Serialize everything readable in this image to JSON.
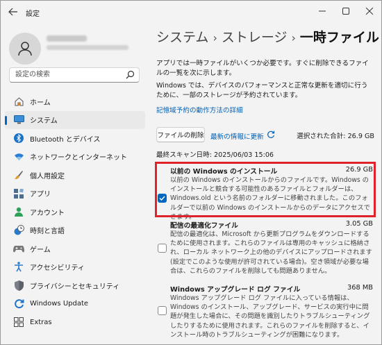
{
  "window": {
    "title": "設定"
  },
  "user": {
    "name": "",
    "email": ""
  },
  "search": {
    "placeholder": "設定の検索"
  },
  "nav": {
    "items": [
      {
        "label": "ホーム",
        "icon": "home-icon"
      },
      {
        "label": "システム",
        "icon": "monitor-icon",
        "active": true
      },
      {
        "label": "Bluetooth とデバイス",
        "icon": "bluetooth-icon"
      },
      {
        "label": "ネットワークとインターネット",
        "icon": "wifi-icon"
      },
      {
        "label": "個人用設定",
        "icon": "brush-icon"
      },
      {
        "label": "アプリ",
        "icon": "apps-icon"
      },
      {
        "label": "アカウント",
        "icon": "person-icon"
      },
      {
        "label": "時刻と言語",
        "icon": "clock-globe-icon"
      },
      {
        "label": "ゲーム",
        "icon": "gamepad-icon"
      },
      {
        "label": "アクセシビリティ",
        "icon": "accessibility-icon"
      },
      {
        "label": "プライバシーとセキュリティ",
        "icon": "shield-icon"
      },
      {
        "label": "Windows Update",
        "icon": "update-icon"
      },
      {
        "label": "Extras",
        "icon": "extras-icon"
      }
    ]
  },
  "breadcrumb": {
    "part1": "システム",
    "part2": "ストレージ",
    "current": "一時ファイル",
    "separator": "›"
  },
  "intro": {
    "text1": "アプリでは一時ファイルがいくつか必要です。すぐに削除できるファイルの一覧を次に示します。",
    "text2": "Windows では、デバイスのパフォーマンスと正常な更新を適切に行うために、一部のストレージが予約されています。",
    "link": "記憶域予約の動作方法の詳細"
  },
  "actions": {
    "delete_label": "ファイルの削除",
    "refresh_label": "最新の情報に更新",
    "selected_total": "選択された合計: 26.9 GB",
    "last_scan": "最終スキャン日時: 2025/06/03 15:06"
  },
  "files": [
    {
      "title": "以前の Windows のインストール",
      "size": "26.9 GB",
      "checked": true,
      "desc": "以前の Windows のインストールからのファイルです。Windows のインストールと競合する可能性のあるファイルとフォルダーは、Windows.old という名前のフォルダーに移動されました。このフォルダーで以前の Windows のインストールからのデータにアクセスできます。"
    },
    {
      "title": "配信の最適化ファイル",
      "size": "3.05 GB",
      "checked": false,
      "desc": "配信の最適化は、Microsoft から更新プログラムをダウンロードするために使用されます。これらのファイルは専用のキャッシュに格納され、ローカル ネットワーク上の他のデバイスにアップロードされます (設定でこのような使用が許可されている場合)。空き領域が必要な場合は、これらのファイルを削除しても問題ありません。"
    },
    {
      "title": "Windows アップグレード ログ ファイル",
      "size": "368 MB",
      "checked": false,
      "desc": "Windows アップグレード ログ ファイルに入っている情報は、Windows のインストール、アップグレード、サービスの実行中に問題が発生した場合に、その問題を識別したりトラブルシューティングしたりするために使用されます。これらのファイルを削除すると、インストール時のトラブルシューティングが困難になります。"
    }
  ],
  "colors": {
    "accent": "#0067c0",
    "highlight": "#e0232a",
    "link": "#0060b8"
  }
}
